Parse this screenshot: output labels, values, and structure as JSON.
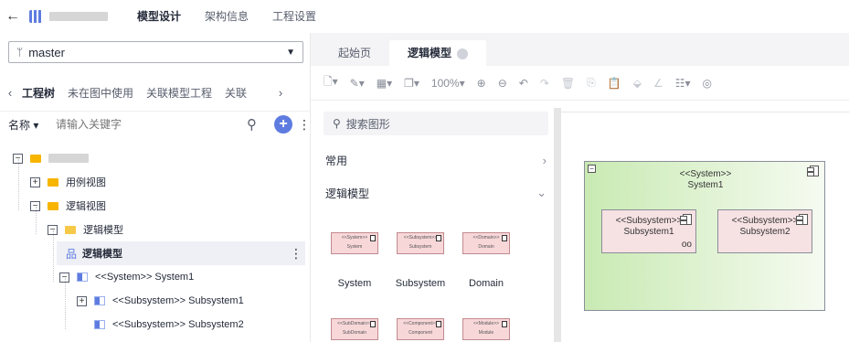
{
  "topbar": {
    "back": "←",
    "tabs": [
      "模型设计",
      "架构信息",
      "工程设置"
    ]
  },
  "branch": {
    "value": "master"
  },
  "subtabs": [
    "工程树",
    "未在图中使用",
    "关联模型工程",
    "关联"
  ],
  "search": {
    "filter": "名称",
    "placeholder": "请输入关键字"
  },
  "tree": {
    "usecase": "用例视图",
    "logicview": "逻辑视图",
    "logicmodel": "逻辑模型",
    "logicmodel_diagram": "逻辑模型",
    "system1": "<<System>> System1",
    "subsystem1": "<<Subsystem>> Subsystem1",
    "subsystem2": "<<Subsystem>> Subsystem2"
  },
  "editor_tabs": [
    "起始页",
    "逻辑模型"
  ],
  "toolbar": {
    "zoom": "100%"
  },
  "palette": {
    "search_placeholder": "搜索图形",
    "group_common": "常用",
    "group_logic": "逻辑模型",
    "shapes": [
      {
        "stereo": "<<System>>",
        "name": "System",
        "label": "System"
      },
      {
        "stereo": "<<Subsystem>>",
        "name": "Subsystem",
        "label": "Subsystem"
      },
      {
        "stereo": "<<Domain>>",
        "name": "Domain",
        "label": "Domain"
      },
      {
        "stereo": "<<SubDomain>>",
        "name": "SubDomain"
      },
      {
        "stereo": "<<Component>>",
        "name": "Component"
      },
      {
        "stereo": "<<Module>>",
        "name": "Module"
      }
    ]
  },
  "canvas": {
    "system": {
      "stereo": "<<System>>",
      "name": "System1"
    },
    "sub1": {
      "stereo": "<<Subsystem>>",
      "name": "Subsystem1"
    },
    "sub2": {
      "stereo": "<<Subsystem>>",
      "name": "Subsystem2"
    }
  }
}
